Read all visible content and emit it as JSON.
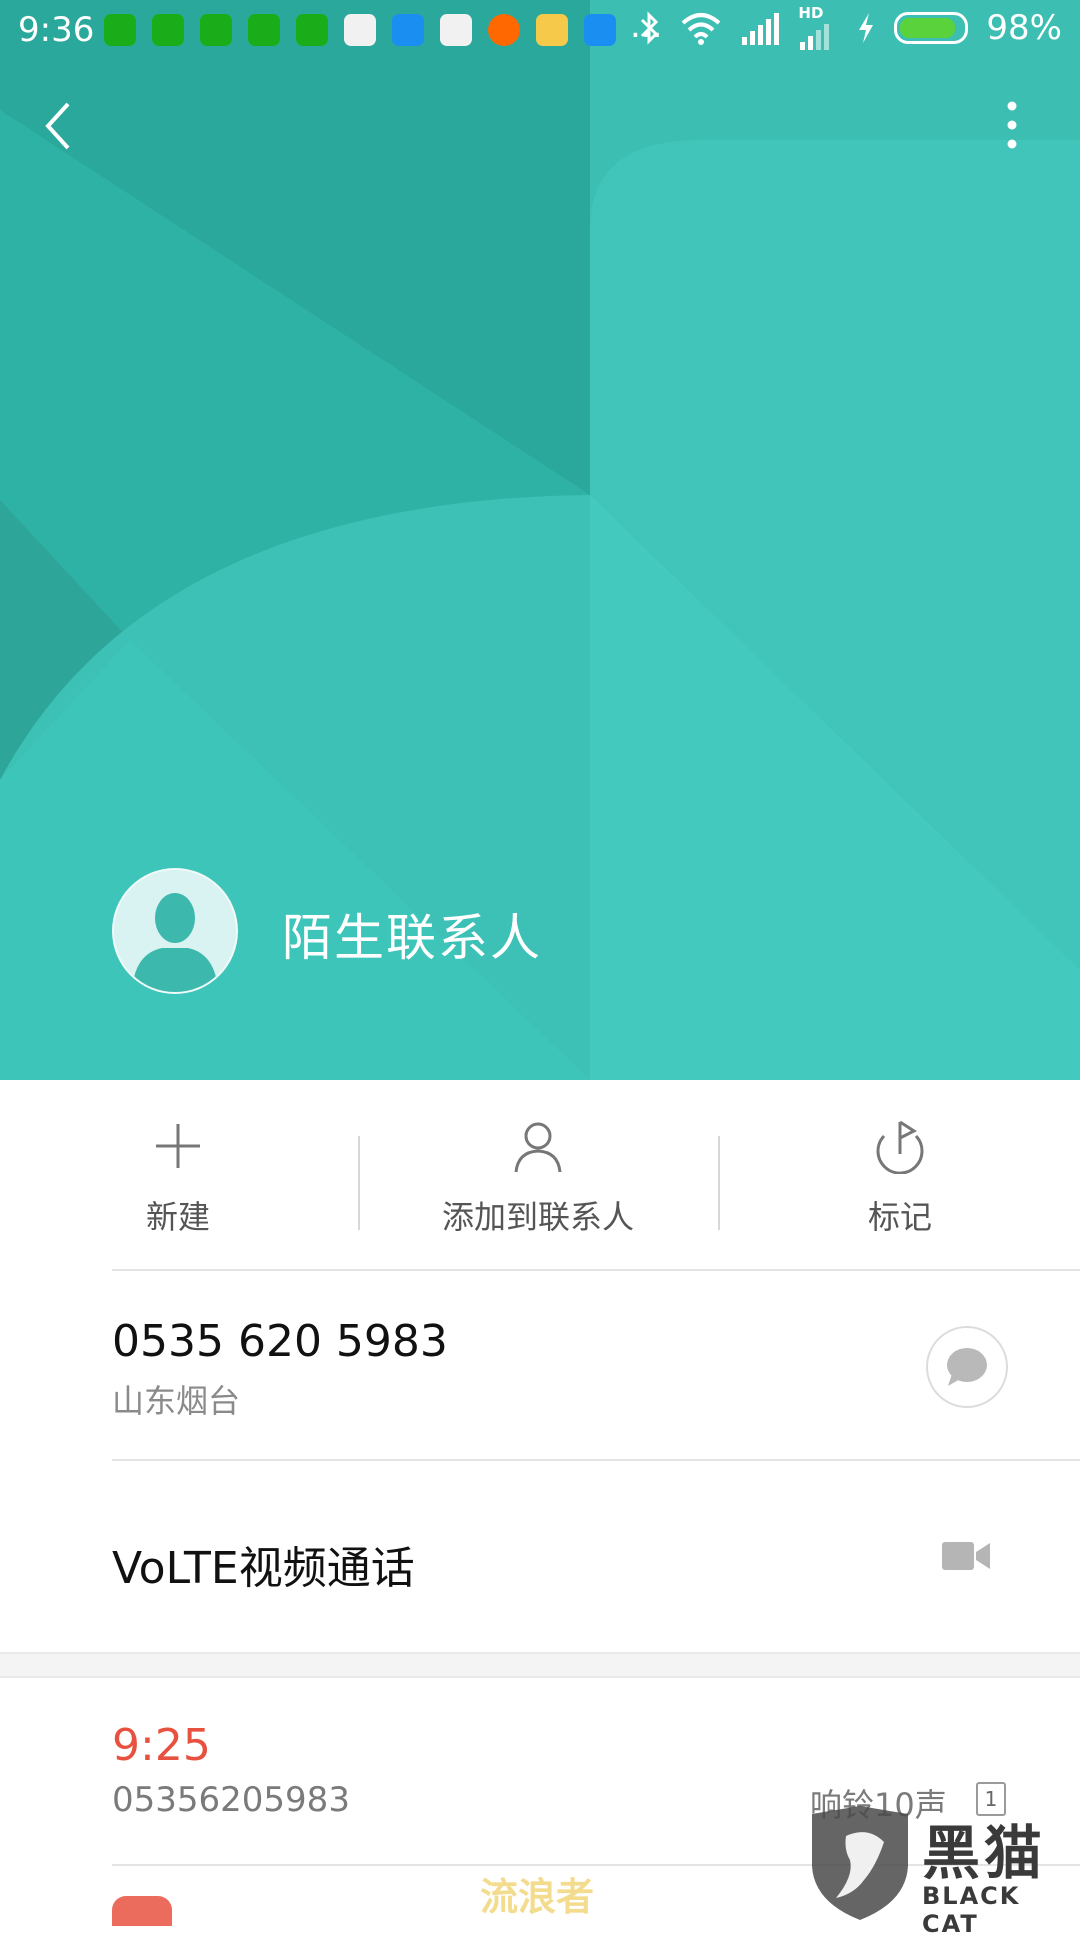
{
  "status_bar": {
    "time": "9:36",
    "battery_percent": "98%",
    "battery_level": 0.98,
    "hd_label": "HD",
    "overflow": "..."
  },
  "header": {
    "contact_name": "陌生联系人",
    "background_color": "#2fb2a6"
  },
  "actions": [
    {
      "label": "新建",
      "icon": "plus-icon"
    },
    {
      "label": "添加到联系人",
      "icon": "person-icon"
    },
    {
      "label": "标记",
      "icon": "flag-icon"
    }
  ],
  "phone": {
    "number": "0535 620 5983",
    "location": "山东烟台"
  },
  "video_call": {
    "label": "VoLTE视频通话"
  },
  "call_log": {
    "time": "9:25",
    "number": "05356205983",
    "ring_info": "响铃10声",
    "sim": "1"
  },
  "watermark": {
    "text": "流浪者",
    "logo_cn": "黑猫",
    "logo_en": "BLACK CAT"
  },
  "colors": {
    "missed_call": "#e8513f",
    "accent": "#2fb2a6"
  }
}
